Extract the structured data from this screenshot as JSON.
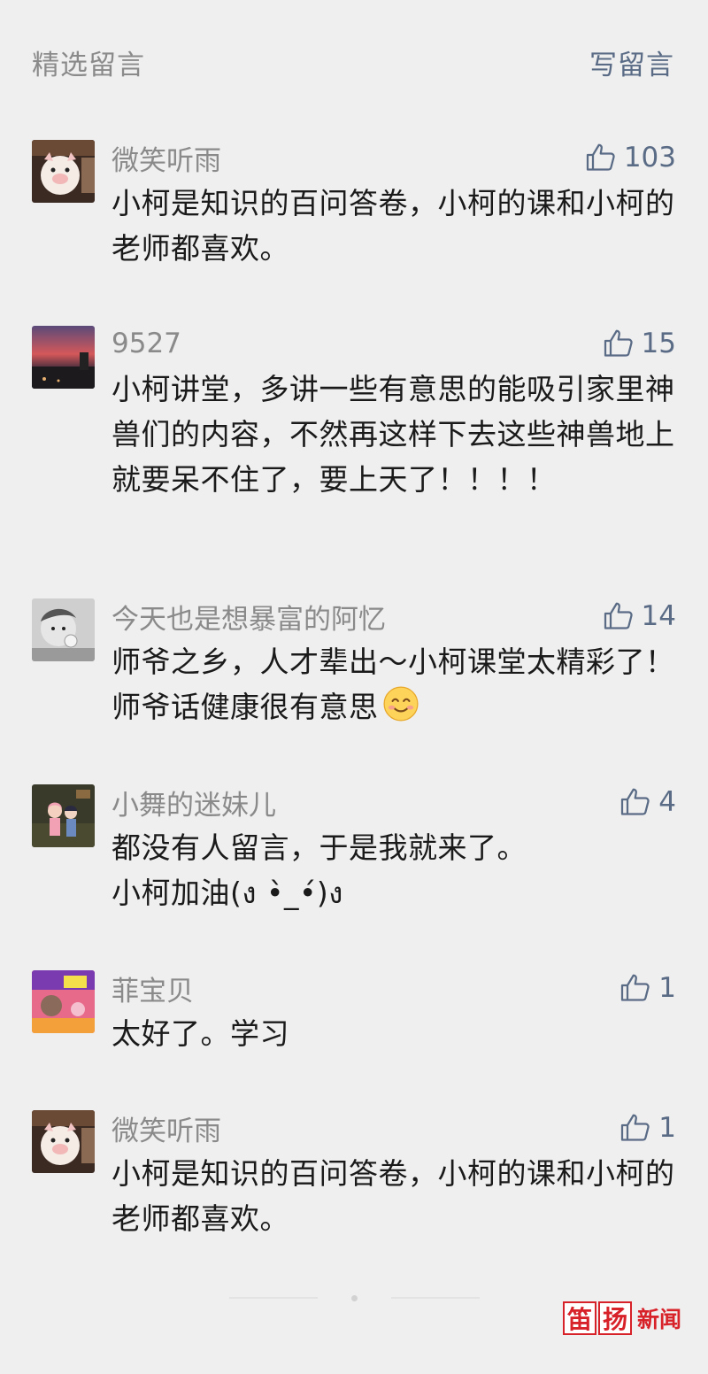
{
  "header": {
    "title": "精选留言",
    "write_label": "写留言"
  },
  "comments": [
    {
      "name": "微笑听雨",
      "likes": "103",
      "text": "小柯是知识的百问答卷，小柯的课和小柯的老师都喜欢。",
      "avatar": "pig-plush-avatar"
    },
    {
      "name": "9527",
      "likes": "15",
      "text": "小柯讲堂，多讲一些有意思的能吸引家里神兽们的内容，不然再这样下去这些神兽地上就要呆不住了，要上天了！！！！",
      "avatar": "sunset-avatar"
    },
    {
      "name": "今天也是想暴富的阿忆",
      "likes": "14",
      "text": "师爷之乡，人才辈出～小柯课堂太精彩了！师爷话健康很有意思",
      "emoji": "smiling-face-icon",
      "avatar": "baby-avatar"
    },
    {
      "name": "小舞的迷妹儿",
      "likes": "4",
      "text": "都没有人留言，于是我就来了。\n小柯加油(ง •̀_•́)ง",
      "avatar": "anime-couple-avatar"
    },
    {
      "name": "菲宝贝",
      "likes": "1",
      "text": "太好了。学习",
      "avatar": "poster-avatar"
    },
    {
      "name": "微笑听雨",
      "likes": "1",
      "text": "小柯是知识的百问答卷，小柯的课和小柯的老师都喜欢。",
      "avatar": "pig-plush-avatar"
    }
  ],
  "watermark": {
    "char1": "笛",
    "char2": "扬",
    "text": "新闻"
  },
  "colors": {
    "background": "#efefef",
    "accent": "#5a6b86",
    "muted": "#8a8a8a",
    "brand_red": "#d8222a"
  }
}
